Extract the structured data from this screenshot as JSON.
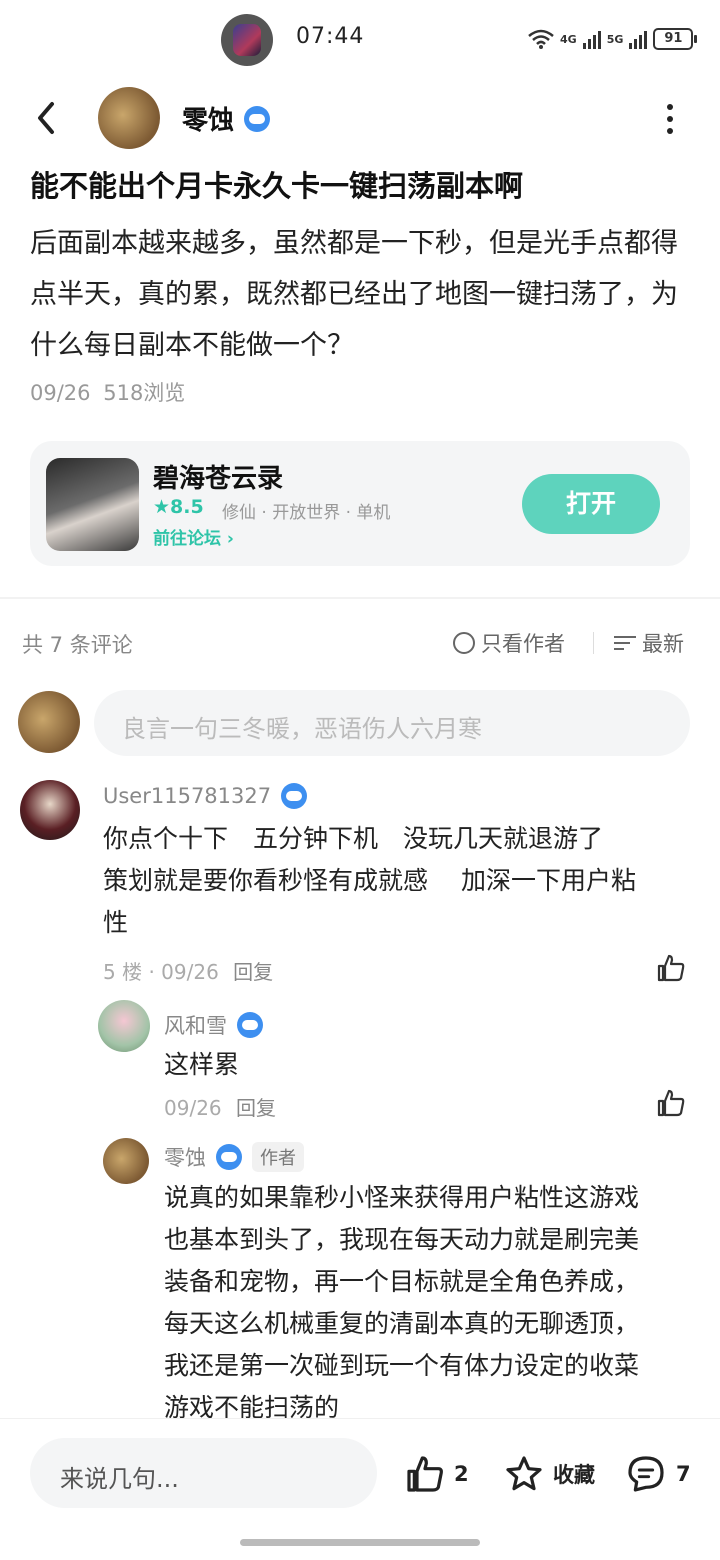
{
  "status_bar": {
    "time": "07:44",
    "network1": "4G",
    "network2": "5G",
    "battery": "91"
  },
  "post": {
    "author": "零蚀",
    "title": "能不能出个月卡永久卡一键扫荡副本啊",
    "body": "后面副本越来越多，虽然都是一下秒，但是光手点都得点半天，真的累，既然都已经出了地图一键扫荡了，为什么每日副本不能做一个？",
    "date": "09/26",
    "views": "518浏览"
  },
  "game": {
    "name": "碧海苍云录",
    "score": "★8.5",
    "tags": "修仙 · 开放世界 · 单机",
    "forum_link": "前往论坛 ›",
    "open_label": "打开"
  },
  "comments_header": {
    "count_label": "共 7 条评论",
    "author_only_label": "只看作者",
    "sort_label": "最新"
  },
  "input": {
    "placeholder": "良言一句三冬暖，恶语伤人六月寒"
  },
  "comments": [
    {
      "user": "User115781327",
      "text_lines": [
        "你点个十下　五分钟下机　没玩几天就退游了",
        "策划就是要你看秒怪有成就感　 加深一下用户粘",
        "性"
      ],
      "meta": "5 楼 · 09/26",
      "reply": "回复"
    },
    {
      "user": "风和雪",
      "text": "这样累",
      "meta": "09/26",
      "reply": "回复"
    },
    {
      "user": "零蚀",
      "tag": "作者",
      "text_lines": [
        "说真的如果靠秒小怪来获得用户粘性这游戏",
        "也基本到头了，我现在每天动力就是刷完美",
        "装备和宠物，再一个目标就是全角色养成，",
        "每天这么机械重复的清副本真的无聊透顶，",
        "我还是第一次碰到玩一个有体力设定的收菜",
        "游戏不能扫荡的"
      ]
    }
  ],
  "bottom_bar": {
    "input_placeholder": "来说几句...",
    "like_count": "2",
    "favorite_label": "收藏",
    "comment_count": "7"
  },
  "colors": {
    "accent": "#5ed3bd",
    "accent_text": "#2ec4a8",
    "badge": "#3d8ff0"
  }
}
